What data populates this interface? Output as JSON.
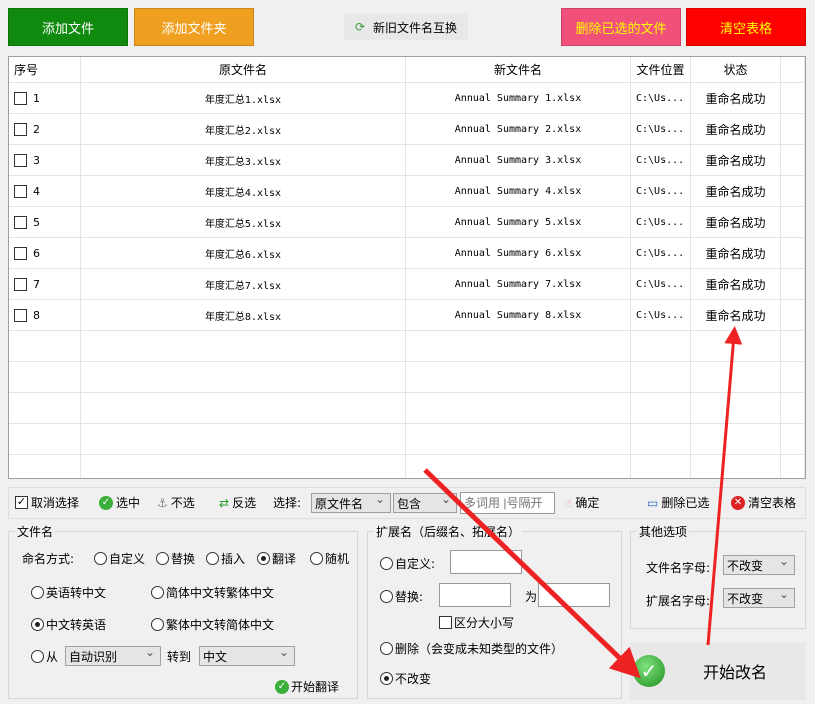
{
  "top": {
    "add_file": "添加文件",
    "add_folder": "添加文件夹",
    "swap": "新旧文件名互换",
    "delete_selected": "删除已选的文件",
    "clear": "清空表格"
  },
  "colors": {
    "add_file": "#0f8a0f",
    "add_folder": "#f0a020",
    "delete_selected": "#f0507a",
    "clear": "#ff0000",
    "delete_text": "#ffff00",
    "clear_text": "#ffff00",
    "arrow": "#ee2222"
  },
  "table": {
    "headers": [
      "序号",
      "原文件名",
      "新文件名",
      "文件位置",
      "状态"
    ],
    "rows": [
      {
        "no": "1",
        "old": "年度汇总1.xlsx",
        "new": "Annual Summary 1.xlsx",
        "path": "C:\\Us...",
        "status": "重命名成功"
      },
      {
        "no": "2",
        "old": "年度汇总2.xlsx",
        "new": "Annual Summary 2.xlsx",
        "path": "C:\\Us...",
        "status": "重命名成功"
      },
      {
        "no": "3",
        "old": "年度汇总3.xlsx",
        "new": "Annual Summary 3.xlsx",
        "path": "C:\\Us...",
        "status": "重命名成功"
      },
      {
        "no": "4",
        "old": "年度汇总4.xlsx",
        "new": "Annual Summary 4.xlsx",
        "path": "C:\\Us...",
        "status": "重命名成功"
      },
      {
        "no": "5",
        "old": "年度汇总5.xlsx",
        "new": "Annual Summary 5.xlsx",
        "path": "C:\\Us...",
        "status": "重命名成功"
      },
      {
        "no": "6",
        "old": "年度汇总6.xlsx",
        "new": "Annual Summary 6.xlsx",
        "path": "C:\\Us...",
        "status": "重命名成功"
      },
      {
        "no": "7",
        "old": "年度汇总7.xlsx",
        "new": "Annual Summary 7.xlsx",
        "path": "C:\\Us...",
        "status": "重命名成功"
      },
      {
        "no": "8",
        "old": "年度汇总8.xlsx",
        "new": "Annual Summary 8.xlsx",
        "path": "C:\\Us...",
        "status": "重命名成功"
      }
    ]
  },
  "toolbar": {
    "deselect": "取消选择",
    "select": "选中",
    "unselect": "不选",
    "invert": "反选",
    "choose_label": "选择:",
    "field": "原文件名",
    "match": "包含",
    "keyword_placeholder": "多词用 |号隔开",
    "confirm": "确定",
    "delete_selected": "删除已选",
    "clear": "清空表格"
  },
  "filename": {
    "title": "文件名",
    "mode_label": "命名方式:",
    "modes": [
      "自定义",
      "替换",
      "插入",
      "翻译",
      "随机"
    ],
    "selected_mode": "翻译",
    "en2zh": "英语转中文",
    "s2t": "简体中文转繁体中文",
    "zh2en": "中文转英语",
    "t2s": "繁体中文转简体中文",
    "from": "从",
    "from_value": "自动识别",
    "to": "转到",
    "to_value": "中文",
    "start_translate": "开始翻译"
  },
  "ext": {
    "title": "扩展名（后缀名、拓展名）",
    "custom": "自定义:",
    "replace": "替换:",
    "as": "为",
    "case": "区分大小写",
    "delete": "删除（会变成未知类型的文件）",
    "keep": "不改变"
  },
  "other": {
    "title": "其他选项",
    "filename_case": "文件名字母:",
    "filename_case_value": "不改变",
    "ext_case": "扩展名字母:",
    "ext_case_value": "不改变"
  },
  "start": "开始改名"
}
